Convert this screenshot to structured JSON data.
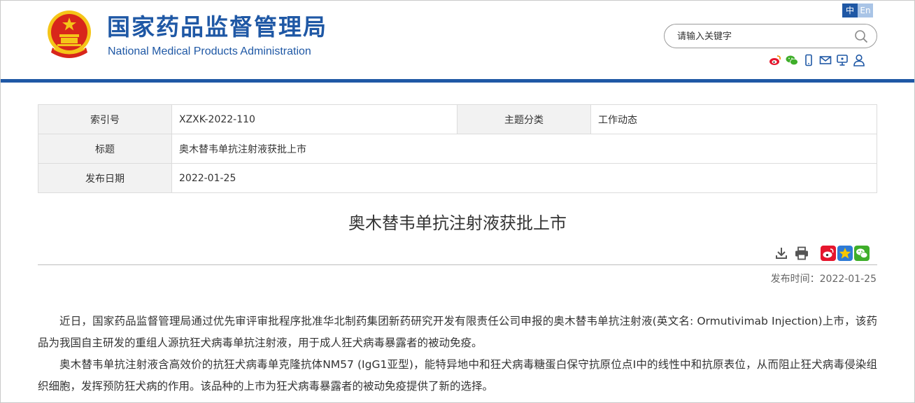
{
  "header": {
    "site_name_cn": "国家药品监督管理局",
    "site_name_en": "National Medical Products Administration",
    "lang_zh": "中",
    "lang_en": "En",
    "search_placeholder": "请输入关键字",
    "social_icons": [
      "weibo-icon",
      "wechat-icon",
      "mobile-icon",
      "mail-icon",
      "feedback-icon",
      "user-icon"
    ],
    "brand_color": "#1f58a5"
  },
  "info": {
    "index_label": "索引号",
    "index_value": "XZXK-2022-110",
    "topic_label": "主题分类",
    "topic_value": "工作动态",
    "title_label": "标题",
    "title_value": "奥木替韦单抗注射液获批上市",
    "date_label": "发布日期",
    "date_value": "2022-01-25"
  },
  "article": {
    "title": "奥木替韦单抗注射液获批上市",
    "pub_label": "发布时间：",
    "pub_date": "2022-01-25",
    "tools": [
      "download-icon",
      "print-icon",
      "weibo-share-icon",
      "favorite-icon",
      "wechat-share-icon"
    ],
    "paragraphs": [
      "近日，国家药品监督管理局通过优先审评审批程序批准华北制药集团新药研究开发有限责任公司申报的奥木替韦单抗注射液(英文名: Ormutivimab Injection)上市，该药品为我国自主研发的重组人源抗狂犬病毒单抗注射液，用于成人狂犬病毒暴露者的被动免疫。",
      "奥木替韦单抗注射液含高效价的抗狂犬病毒单克隆抗体NM57 (IgG1亚型)，能特异地中和狂犬病毒糖蛋白保守抗原位点I中的线性中和抗原表位，从而阻止狂犬病毒侵染组织细胞，发挥预防狂犬病的作用。该品种的上市为狂犬病毒暴露者的被动免疫提供了新的选择。"
    ]
  }
}
